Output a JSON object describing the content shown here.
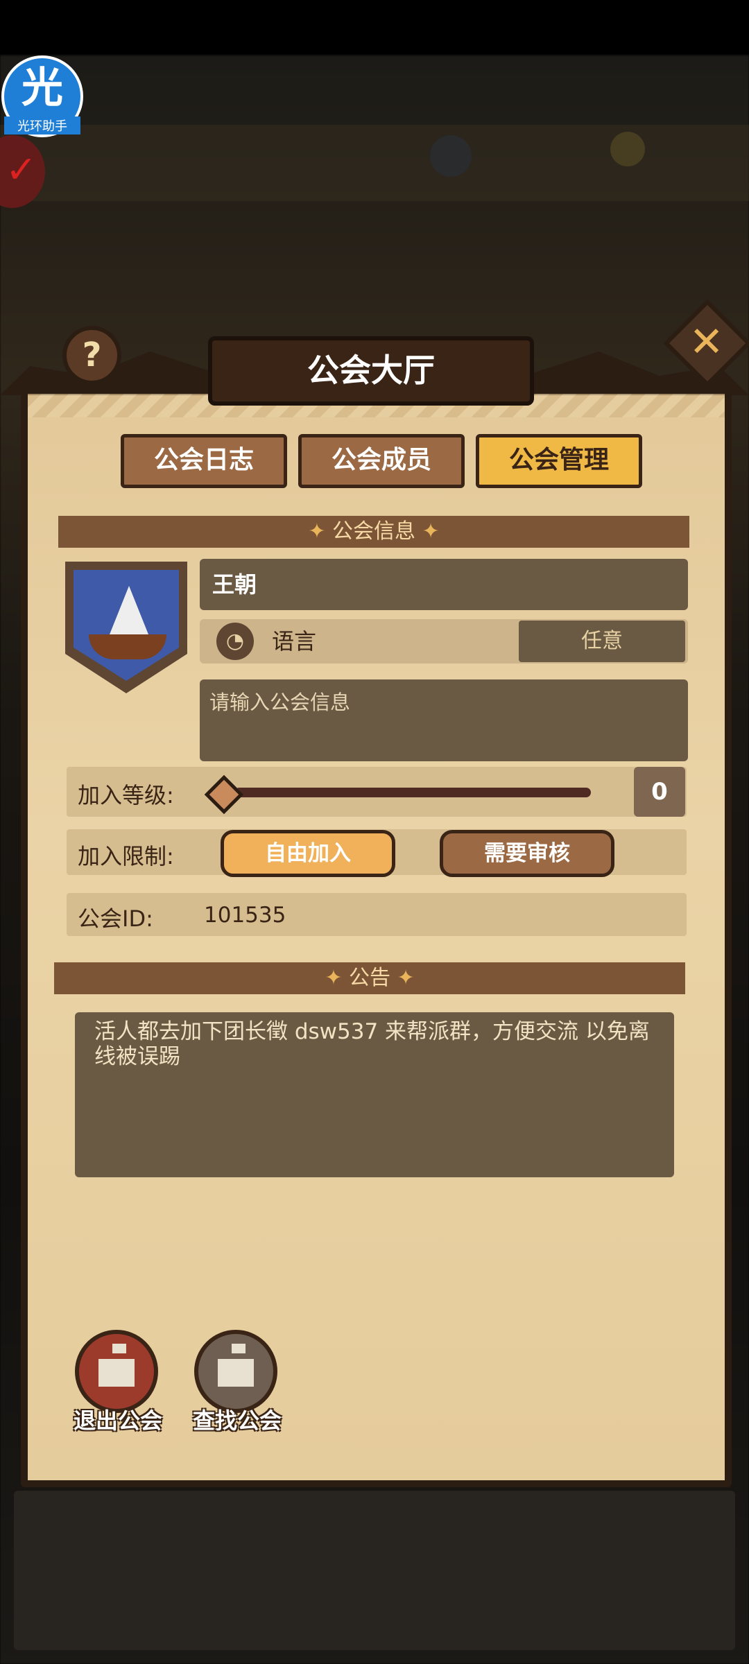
{
  "assistant": {
    "glyph": "光",
    "label": "光环助手"
  },
  "panel": {
    "title": "公会大厅",
    "help_symbol": "?",
    "close_symbol": "✕"
  },
  "tabs": [
    {
      "label": "公会日志",
      "active": false
    },
    {
      "label": "公会成员",
      "active": false
    },
    {
      "label": "公会管理",
      "active": true
    }
  ],
  "guild_info": {
    "section_title": "公会信息",
    "name": "王朝",
    "language_label": "语言",
    "language_value": "任意",
    "info_placeholder": "请输入公会信息",
    "join_level_label": "加入等级:",
    "join_level_value": "0",
    "join_restriction_label": "加入限制:",
    "restriction_options": [
      "自由加入",
      "需要审核"
    ],
    "selected_restriction": "自由加入",
    "guild_id_label": "公会ID:",
    "guild_id_value": "101535"
  },
  "notice": {
    "section_title": "公告",
    "text": "活人都去加下团长徵 dsw537 来帮派群，方便交流 以免离线被误踢"
  },
  "actions": {
    "leave_label": "退出公会",
    "find_label": "查找公会"
  },
  "colors": {
    "panel_bg": "#e3c99a",
    "frame": "#2b1d12",
    "active_tab": "#f0b946",
    "inactive_tab": "#9b6a44",
    "field_bg": "#6b5a43",
    "section_bar": "#7b5536"
  }
}
